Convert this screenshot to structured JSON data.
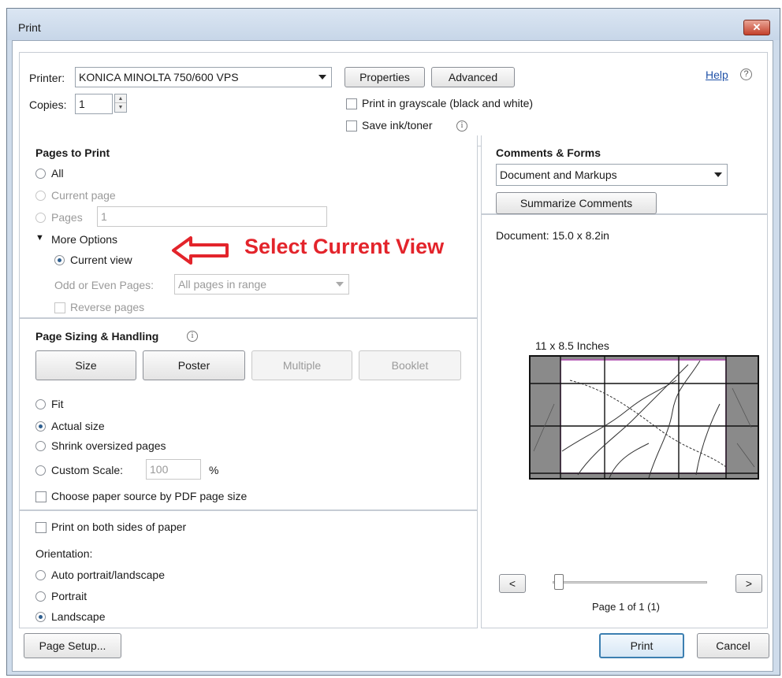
{
  "window": {
    "title": "Print",
    "close_glyph": "✕"
  },
  "printer": {
    "label": "Printer:",
    "value": "KONICA MINOLTA 750/600 VPS",
    "properties_button": "Properties",
    "advanced_button": "Advanced",
    "help_link": "Help",
    "copies_label": "Copies:",
    "copies_value": "1",
    "grayscale_label": "Print in grayscale (black and white)",
    "save_ink_label": "Save ink/toner"
  },
  "pages_to_print": {
    "heading": "Pages to Print",
    "all_label": "All",
    "current_page_label": "Current page",
    "pages_label": "Pages",
    "pages_value": "1",
    "more_options_label": "More Options",
    "current_view_label": "Current view",
    "odd_even_label": "Odd or Even Pages:",
    "odd_even_value": "All pages in range",
    "reverse_label": "Reverse pages"
  },
  "annotation": {
    "text": "Select Current View",
    "color": "#e3242b"
  },
  "page_sizing": {
    "heading": "Page Sizing & Handling",
    "buttons": {
      "size": "Size",
      "poster": "Poster",
      "multiple": "Multiple",
      "booklet": "Booklet"
    },
    "fit_label": "Fit",
    "actual_size_label": "Actual size",
    "shrink_label": "Shrink oversized pages",
    "custom_scale_label": "Custom Scale:",
    "custom_scale_value": "100",
    "percent": "%",
    "paper_source_label": "Choose paper source by PDF page size"
  },
  "duplex": {
    "both_sides_label": "Print on both sides of paper",
    "orientation_label": "Orientation:",
    "auto_label": "Auto portrait/landscape",
    "portrait_label": "Portrait",
    "landscape_label": "Landscape"
  },
  "comments_forms": {
    "heading": "Comments & Forms",
    "value": "Document and Markups",
    "summarize_button": "Summarize Comments"
  },
  "preview": {
    "document_size": "Document: 15.0 x 8.2in",
    "paper_size": "11 x 8.5 Inches",
    "prev_button": "<",
    "next_button": ">",
    "page_indicator": "Page 1 of 1 (1)",
    "slider_position": 0
  },
  "footer": {
    "page_setup_button": "Page Setup...",
    "print_button": "Print",
    "cancel_button": "Cancel"
  }
}
